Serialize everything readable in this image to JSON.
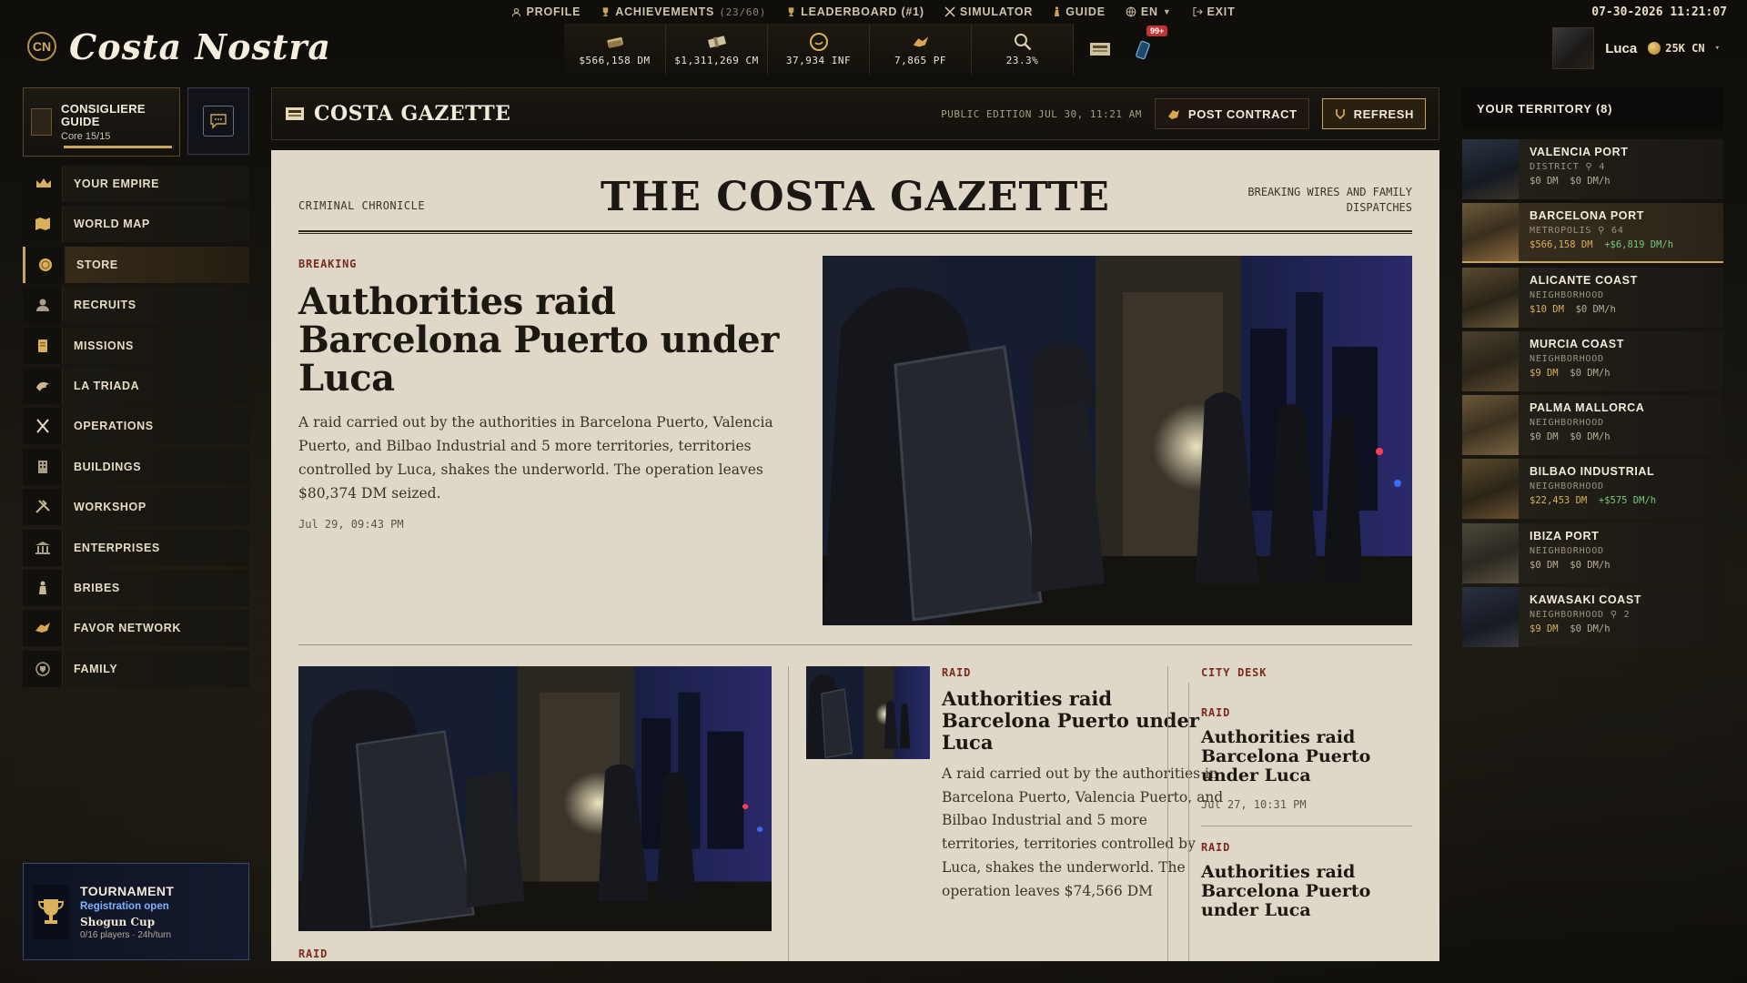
{
  "topnav": {
    "items": [
      {
        "label": "PROFILE",
        "icon": "person-icon"
      },
      {
        "label": "ACHIEVEMENTS",
        "extra": "(23/60)",
        "icon": "trophy-icon"
      },
      {
        "label": "LEADERBOARD (#1)",
        "icon": "trophy-icon"
      },
      {
        "label": "SIMULATOR",
        "icon": "crossed-swords-icon"
      },
      {
        "label": "GUIDE",
        "icon": "figure-icon"
      },
      {
        "label": "EN",
        "icon": "globe-icon"
      },
      {
        "label": "EXIT",
        "icon": "exit-icon"
      }
    ],
    "clock": "07-30-2026 11:21:07"
  },
  "logo": {
    "text": "Costa Nostra"
  },
  "resources": [
    {
      "value": "$566,158 DM",
      "icon": "cash-stack-icon"
    },
    {
      "value": "$1,311,269 CM",
      "icon": "money-bundle-icon"
    },
    {
      "value": "37,934 INF",
      "icon": "influence-coin-icon"
    },
    {
      "value": "7,865 PF",
      "icon": "handshake-icon"
    },
    {
      "value": "23.3%",
      "icon": "magnifier-icon"
    }
  ],
  "notifications": {
    "badge": "99+"
  },
  "user": {
    "name": "Luca",
    "currency": "25K CN"
  },
  "guide": {
    "title": "CONSIGLIERE GUIDE",
    "sub": "Core 15/15",
    "progress": 1.0
  },
  "menu": [
    {
      "label": "YOUR EMPIRE",
      "icon": "crown-icon"
    },
    {
      "label": "WORLD MAP",
      "icon": "map-icon"
    },
    {
      "label": "STORE",
      "icon": "coin-icon",
      "active": true
    },
    {
      "label": "RECRUITS",
      "icon": "recruit-icon"
    },
    {
      "label": "MISSIONS",
      "icon": "scroll-icon"
    },
    {
      "label": "LA TRIADA",
      "icon": "dragon-icon"
    },
    {
      "label": "OPERATIONS",
      "icon": "crossed-knives-icon"
    },
    {
      "label": "BUILDINGS",
      "icon": "building-icon"
    },
    {
      "label": "WORKSHOP",
      "icon": "tools-icon"
    },
    {
      "label": "ENTERPRISES",
      "icon": "bank-icon"
    },
    {
      "label": "BRIBES",
      "icon": "bribe-figure-icon"
    },
    {
      "label": "FAVOR NETWORK",
      "icon": "handshake-icon"
    },
    {
      "label": "FAMILY",
      "icon": "family-crest-icon"
    }
  ],
  "tournament": {
    "title": "TOURNAMENT",
    "status": "Registration open",
    "name": "Shogun Cup",
    "meta": "0/16 players · 24h/turn"
  },
  "gazette": {
    "header_title": "COSTA GAZETTE",
    "edition": "PUBLIC EDITION  JUL 30, 11:21 AM",
    "post_label": "POST CONTRACT",
    "refresh_label": "REFRESH",
    "masthead_left": "CRIMINAL CHRONICLE",
    "masthead_title": "THE COSTA GAZETTE",
    "masthead_right": "BREAKING WIRES AND FAMILY DISPATCHES",
    "lead": {
      "kicker": "BREAKING",
      "headline": "Authorities raid Barcelona Puerto under Luca",
      "body": "A raid carried out by the authorities in Barcelona Puerto, Valencia Puerto, and Bilbao Industrial and 5 more territories, territories controlled by Luca, shakes the underworld. The operation leaves $80,374 DM seized.",
      "date": "Jul 29, 09:43 PM"
    },
    "bottom_left_kicker": "RAID",
    "mid": {
      "kicker": "RAID",
      "headline": "Authorities raid Barcelona Puerto under Luca",
      "body": "A raid carried out by the authorities in Barcelona Puerto, Valencia Puerto, and Bilbao Industrial and 5 more territories, territories controlled by Luca, shakes the underworld. The operation leaves $74,566 DM"
    },
    "city_desk": {
      "label": "CITY DESK",
      "items": [
        {
          "kicker": "RAID",
          "headline": "Authorities raid Barcelona Puerto under Luca",
          "date": "Jul 27, 10:31 PM"
        },
        {
          "kicker": "RAID",
          "headline": "Authorities raid Barcelona Puerto under Luca"
        }
      ]
    }
  },
  "territory": {
    "header": "YOUR TERRITORY (8)",
    "items": [
      {
        "name": "VALENCIA PORT",
        "type": "DISTRICT",
        "level": "4",
        "v1": "$0 DM",
        "v2": "$0 DM/h"
      },
      {
        "name": "BARCELONA PORT",
        "type": "METROPOLIS",
        "level": "64",
        "v1": "$566,158 DM",
        "v2": "+$6,819 DM/h",
        "selected": true
      },
      {
        "name": "ALICANTE COAST",
        "type": "NEIGHBORHOOD",
        "level": "",
        "v1": "$10 DM",
        "v2": "$0 DM/h"
      },
      {
        "name": "MURCIA COAST",
        "type": "NEIGHBORHOOD",
        "level": "",
        "v1": "$9 DM",
        "v2": "$0 DM/h"
      },
      {
        "name": "PALMA MALLORCA",
        "type": "NEIGHBORHOOD",
        "level": "",
        "v1": "$0 DM",
        "v2": "$0 DM/h"
      },
      {
        "name": "BILBAO INDUSTRIAL",
        "type": "NEIGHBORHOOD",
        "level": "",
        "v1": "$22,453 DM",
        "v2": "+$575 DM/h"
      },
      {
        "name": "IBIZA PORT",
        "type": "NEIGHBORHOOD",
        "level": "",
        "v1": "$0 DM",
        "v2": "$0 DM/h"
      },
      {
        "name": "KAWASAKI COAST",
        "type": "NEIGHBORHOOD",
        "level": "2",
        "v1": "$9 DM",
        "v2": "$0 DM/h"
      }
    ]
  },
  "colors": {
    "accent": "#c9a45b",
    "paper": "#dfd8c9",
    "kicker": "#7a2a1f",
    "positive": "#78c87a"
  }
}
